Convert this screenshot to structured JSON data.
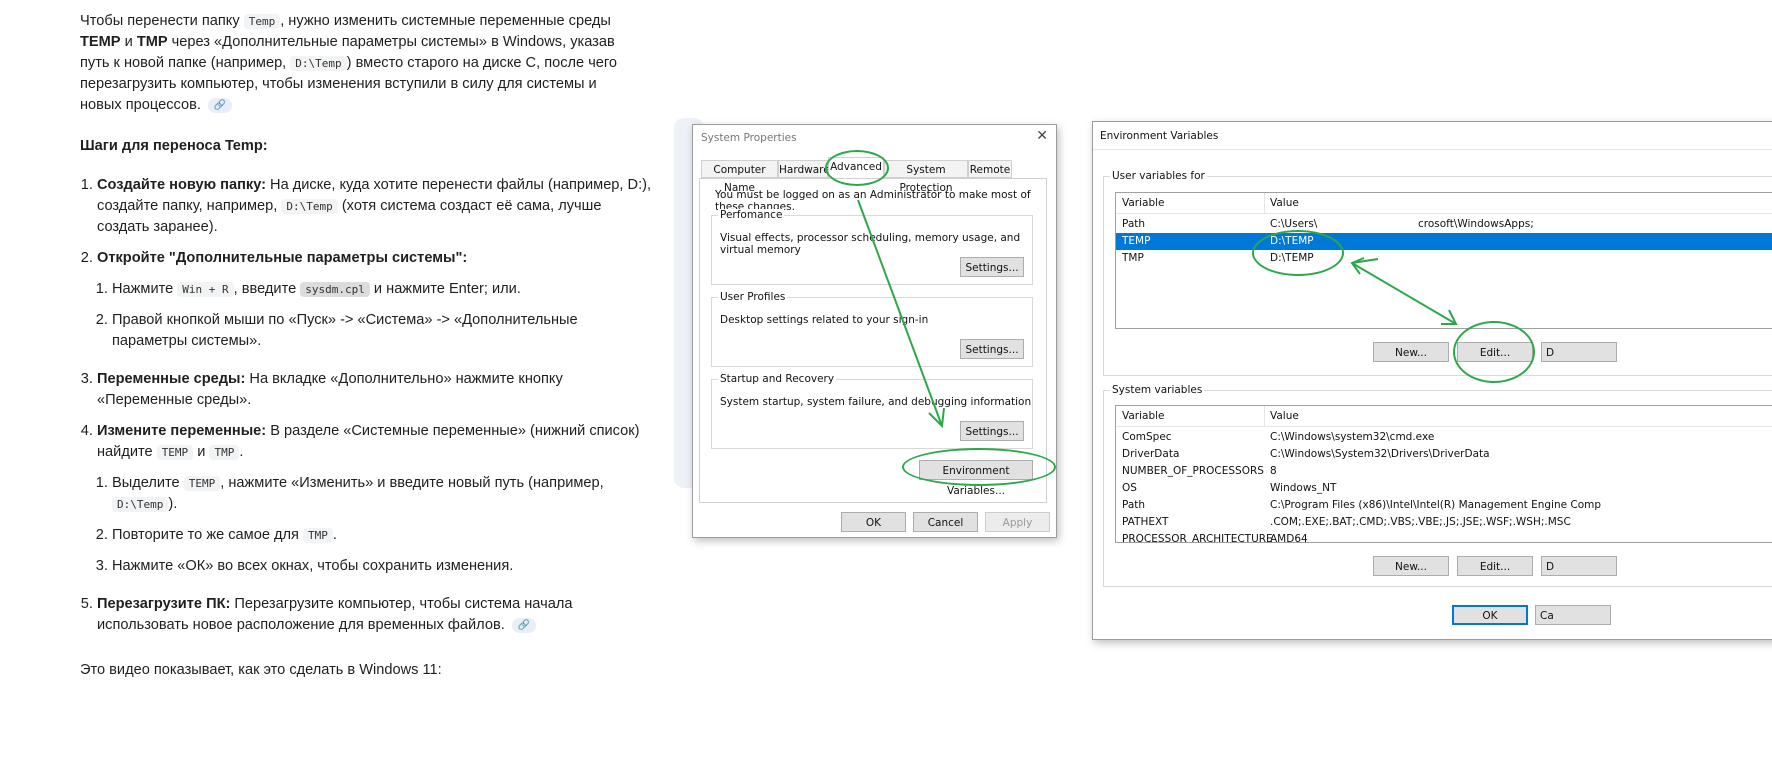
{
  "article": {
    "intro": {
      "t1": "Чтобы перенести папку ",
      "c1": "Temp",
      "t2": ", нужно изменить системные переменные среды ",
      "b1": "TEMP",
      "t3": " и ",
      "b2": "TMP",
      "t4": " через «Дополнительные параметры системы» в Windows, указав путь к новой папке (например, ",
      "c2": "D:\\Temp",
      "t5": ") вместо старого на диске C, после чего перезагрузить компьютер, чтобы изменения вступили в силу для системы и новых процессов."
    },
    "heading": "Шаги для переноса Temp:",
    "s1": {
      "b": "Создайте новую папку:",
      "t1": " На диске, куда хотите перенести файлы (например, D:), создайте папку, например, ",
      "c": "D:\\Temp",
      "t2": " (хотя система создаст её сама, лучше создать заранее)."
    },
    "s2": {
      "b": "Откройте \"Дополнительные параметры системы\":",
      "a": {
        "t1": "Нажмите ",
        "c1": "Win + R",
        "t2": ", введите ",
        "c2": "sysdm.cpl",
        "t3": " и нажмите Enter; или."
      },
      "b2": "Правой кнопкой мыши по «Пуск» -> «Система» -> «Дополнительные параметры системы»."
    },
    "s3": {
      "b": "Переменные среды:",
      "t": " На вкладке «Дополнительно» нажмите кнопку «Переменные среды»."
    },
    "s4": {
      "b": "Измените переменные:",
      "t1": " В разделе «Системные переменные» (нижний список) найдите ",
      "c1": "TEMP",
      "t2": " и ",
      "c2": "TMP",
      "t3": ".",
      "a": {
        "t1": "Выделите ",
        "c1": "TEMP",
        "t2": ", нажмите «Изменить» и введите новый путь (например, ",
        "c2": "D:\\Temp",
        "t3": ")."
      },
      "b2": {
        "t1": "Повторите то же самое для ",
        "c": "TMP",
        "t2": "."
      },
      "c3": "Нажмите «ОК» во всех окнах, чтобы сохранить изменения."
    },
    "s5": {
      "b": "Перезагрузите ПК:",
      "t": " Перезагрузите компьютер, чтобы система начала использовать новое расположение для временных файлов."
    },
    "footer": "Это видео показывает, как это сделать в Windows 11:"
  },
  "sysprops": {
    "title": "System Properties",
    "tabs": [
      "Computer Name",
      "Hardware",
      "Advanced",
      "System Protection",
      "Remote"
    ],
    "admin_note": "You must be logged on as an Administrator to make most of these changes.",
    "perf_title": "Perfomance",
    "perf_desc": "Visual effects, processor scheduling, memory usage, and virtual memory",
    "profiles_title": "User Profiles",
    "profiles_desc": "Desktop settings related to your sign-in",
    "startup_title": "Startup and Recovery",
    "startup_desc": "System startup, system failure, and debugging information",
    "settings": "Settings...",
    "env_button": "Environment Variables...",
    "ok": "OK",
    "cancel": "Cancel",
    "apply": "Apply"
  },
  "envvars": {
    "title": "Environment Variables",
    "user_label": "User variables for",
    "col_var": "Variable",
    "col_val": "Value",
    "user_rows": [
      {
        "name": "Path",
        "value": "C:\\Users\\",
        "value_tail": "crosoft\\WindowsApps;"
      },
      {
        "name": "TEMP",
        "value": "D:\\TEMP"
      },
      {
        "name": "TMP",
        "value": "D:\\TEMP"
      }
    ],
    "system_label": "System variables",
    "system_rows": [
      {
        "name": "ComSpec",
        "value": "C:\\Windows\\system32\\cmd.exe"
      },
      {
        "name": "DriverData",
        "value": "C:\\Windows\\System32\\Drivers\\DriverData"
      },
      {
        "name": "NUMBER_OF_PROCESSORS",
        "value": "8"
      },
      {
        "name": "OS",
        "value": "Windows_NT"
      },
      {
        "name": "Path",
        "value": "C:\\Program Files (x86)\\Intel\\Intel(R) Management Engine Comp"
      },
      {
        "name": "PATHEXT",
        "value": ".COM;.EXE;.BAT;.CMD;.VBS;.VBE;.JS;.JSE;.WSF;.WSH;.MSC"
      },
      {
        "name": "PROCESSOR_ARCHITECTURE",
        "value": "AMD64"
      }
    ],
    "new": "New...",
    "edit": "Edit...",
    "delete_partial": "D",
    "ok": "OK",
    "cancel_partial": "Ca"
  },
  "colors": {
    "annotation": "#2ca84a",
    "selection": "#0078d7"
  },
  "icons": {
    "link_chip": "link-icon"
  }
}
